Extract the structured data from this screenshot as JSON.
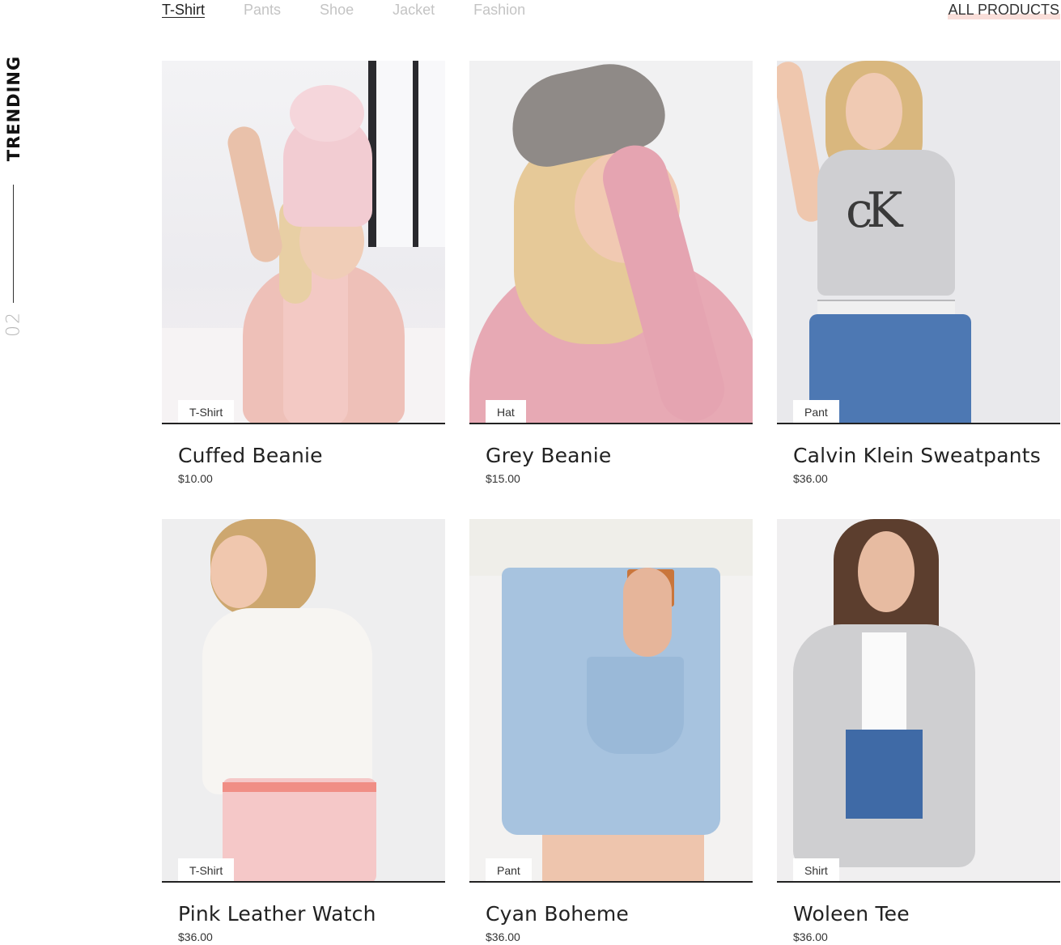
{
  "rail": {
    "title": "TRENDING",
    "number": "02"
  },
  "filters": {
    "items": [
      "T-Shirt",
      "Pants",
      "Shoe",
      "Jacket",
      "Fashion"
    ],
    "active": "T-Shirt",
    "all_products_label": "ALL PRODUCTS"
  },
  "products": [
    {
      "tag": "T-Shirt",
      "name": "Cuffed Beanie",
      "price": "$10.00"
    },
    {
      "tag": "Hat",
      "name": "Grey Beanie",
      "price": "$15.00"
    },
    {
      "tag": "Pant",
      "name": "Calvin Klein Sweatpants",
      "price": "$36.00"
    },
    {
      "tag": "T-Shirt",
      "name": "Pink Leather Watch",
      "price": "$36.00"
    },
    {
      "tag": "Pant",
      "name": "Cyan Boheme",
      "price": "$36.00"
    },
    {
      "tag": "Shirt",
      "name": "Woleen Tee",
      "price": "$36.00"
    }
  ],
  "colors": {
    "accent_underline": "#f9ded9",
    "active_filter": "#222222",
    "inactive_filter": "#c4c4c4"
  }
}
